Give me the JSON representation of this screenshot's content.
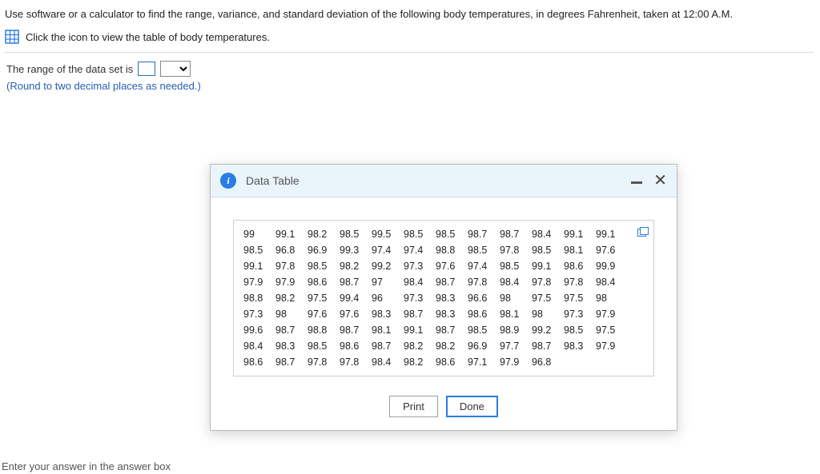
{
  "question": {
    "prompt": "Use software or a calculator to find the range, variance, and standard deviation of the following body temperatures, in degrees Fahrenheit, taken at 12:00 A.M.",
    "iconLine": "Click the icon to view the table of body temperatures.",
    "answerPrefix": "The range of the data set is",
    "hint": "(Round to two decimal places as needed.)",
    "footer": "Enter your answer in the answer box"
  },
  "modal": {
    "title": "Data Table",
    "printLabel": "Print",
    "doneLabel": "Done",
    "rows": [
      [
        "99",
        "99.1",
        "98.2",
        "98.5",
        "99.5",
        "98.5",
        "98.5",
        "98.7",
        "98.7",
        "98.4",
        "99.1",
        "99.1"
      ],
      [
        "98.5",
        "96.8",
        "96.9",
        "99.3",
        "97.4",
        "97.4",
        "98.8",
        "98.5",
        "97.8",
        "98.5",
        "98.1",
        "97.6"
      ],
      [
        "99.1",
        "97.8",
        "98.5",
        "98.2",
        "99.2",
        "97.3",
        "97.6",
        "97.4",
        "98.5",
        "99.1",
        "98.6",
        "99.9"
      ],
      [
        "97.9",
        "97.9",
        "98.6",
        "98.7",
        "97",
        "98.4",
        "98.7",
        "97.8",
        "98.4",
        "97.8",
        "97.8",
        "98.4"
      ],
      [
        "98.8",
        "98.2",
        "97.5",
        "99.4",
        "96",
        "97.3",
        "98.3",
        "96.6",
        "98",
        "97.5",
        "97.5",
        "98"
      ],
      [
        "97.3",
        "98",
        "97.6",
        "97.6",
        "98.3",
        "98.7",
        "98.3",
        "98.6",
        "98.1",
        "98",
        "97.3",
        "97.9"
      ],
      [
        "99.6",
        "98.7",
        "98.8",
        "98.7",
        "98.1",
        "99.1",
        "98.7",
        "98.5",
        "98.9",
        "99.2",
        "98.5",
        "97.5"
      ],
      [
        "98.4",
        "98.3",
        "98.5",
        "98.6",
        "98.7",
        "98.2",
        "98.2",
        "96.9",
        "97.7",
        "98.7",
        "98.3",
        "97.9"
      ],
      [
        "98.6",
        "98.7",
        "97.8",
        "97.8",
        "98.4",
        "98.2",
        "98.6",
        "97.1",
        "97.9",
        "96.8"
      ]
    ]
  }
}
